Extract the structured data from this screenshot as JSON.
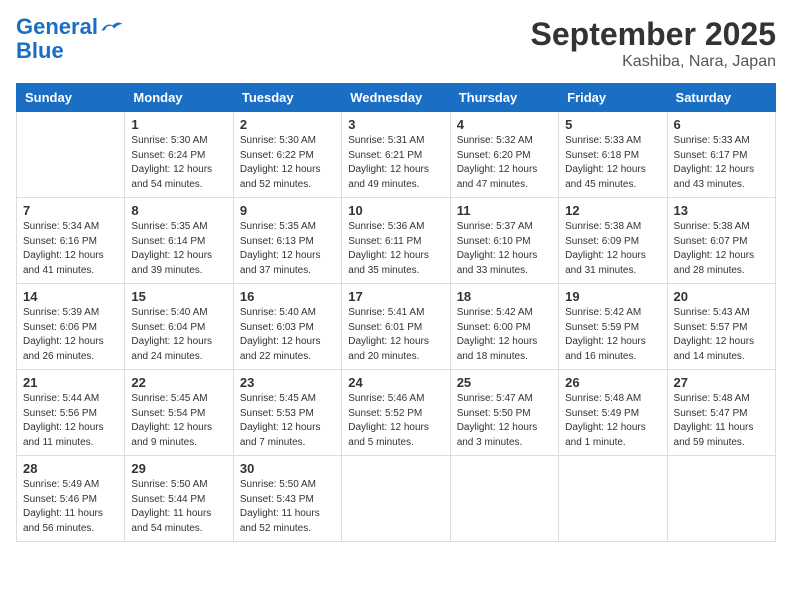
{
  "header": {
    "logo_top": "General",
    "logo_bottom": "Blue",
    "title": "September 2025",
    "subtitle": "Kashiba, Nara, Japan"
  },
  "columns": [
    "Sunday",
    "Monday",
    "Tuesday",
    "Wednesday",
    "Thursday",
    "Friday",
    "Saturday"
  ],
  "weeks": [
    [
      {
        "num": "",
        "info": ""
      },
      {
        "num": "1",
        "info": "Sunrise: 5:30 AM\nSunset: 6:24 PM\nDaylight: 12 hours\nand 54 minutes."
      },
      {
        "num": "2",
        "info": "Sunrise: 5:30 AM\nSunset: 6:22 PM\nDaylight: 12 hours\nand 52 minutes."
      },
      {
        "num": "3",
        "info": "Sunrise: 5:31 AM\nSunset: 6:21 PM\nDaylight: 12 hours\nand 49 minutes."
      },
      {
        "num": "4",
        "info": "Sunrise: 5:32 AM\nSunset: 6:20 PM\nDaylight: 12 hours\nand 47 minutes."
      },
      {
        "num": "5",
        "info": "Sunrise: 5:33 AM\nSunset: 6:18 PM\nDaylight: 12 hours\nand 45 minutes."
      },
      {
        "num": "6",
        "info": "Sunrise: 5:33 AM\nSunset: 6:17 PM\nDaylight: 12 hours\nand 43 minutes."
      }
    ],
    [
      {
        "num": "7",
        "info": "Sunrise: 5:34 AM\nSunset: 6:16 PM\nDaylight: 12 hours\nand 41 minutes."
      },
      {
        "num": "8",
        "info": "Sunrise: 5:35 AM\nSunset: 6:14 PM\nDaylight: 12 hours\nand 39 minutes."
      },
      {
        "num": "9",
        "info": "Sunrise: 5:35 AM\nSunset: 6:13 PM\nDaylight: 12 hours\nand 37 minutes."
      },
      {
        "num": "10",
        "info": "Sunrise: 5:36 AM\nSunset: 6:11 PM\nDaylight: 12 hours\nand 35 minutes."
      },
      {
        "num": "11",
        "info": "Sunrise: 5:37 AM\nSunset: 6:10 PM\nDaylight: 12 hours\nand 33 minutes."
      },
      {
        "num": "12",
        "info": "Sunrise: 5:38 AM\nSunset: 6:09 PM\nDaylight: 12 hours\nand 31 minutes."
      },
      {
        "num": "13",
        "info": "Sunrise: 5:38 AM\nSunset: 6:07 PM\nDaylight: 12 hours\nand 28 minutes."
      }
    ],
    [
      {
        "num": "14",
        "info": "Sunrise: 5:39 AM\nSunset: 6:06 PM\nDaylight: 12 hours\nand 26 minutes."
      },
      {
        "num": "15",
        "info": "Sunrise: 5:40 AM\nSunset: 6:04 PM\nDaylight: 12 hours\nand 24 minutes."
      },
      {
        "num": "16",
        "info": "Sunrise: 5:40 AM\nSunset: 6:03 PM\nDaylight: 12 hours\nand 22 minutes."
      },
      {
        "num": "17",
        "info": "Sunrise: 5:41 AM\nSunset: 6:01 PM\nDaylight: 12 hours\nand 20 minutes."
      },
      {
        "num": "18",
        "info": "Sunrise: 5:42 AM\nSunset: 6:00 PM\nDaylight: 12 hours\nand 18 minutes."
      },
      {
        "num": "19",
        "info": "Sunrise: 5:42 AM\nSunset: 5:59 PM\nDaylight: 12 hours\nand 16 minutes."
      },
      {
        "num": "20",
        "info": "Sunrise: 5:43 AM\nSunset: 5:57 PM\nDaylight: 12 hours\nand 14 minutes."
      }
    ],
    [
      {
        "num": "21",
        "info": "Sunrise: 5:44 AM\nSunset: 5:56 PM\nDaylight: 12 hours\nand 11 minutes."
      },
      {
        "num": "22",
        "info": "Sunrise: 5:45 AM\nSunset: 5:54 PM\nDaylight: 12 hours\nand 9 minutes."
      },
      {
        "num": "23",
        "info": "Sunrise: 5:45 AM\nSunset: 5:53 PM\nDaylight: 12 hours\nand 7 minutes."
      },
      {
        "num": "24",
        "info": "Sunrise: 5:46 AM\nSunset: 5:52 PM\nDaylight: 12 hours\nand 5 minutes."
      },
      {
        "num": "25",
        "info": "Sunrise: 5:47 AM\nSunset: 5:50 PM\nDaylight: 12 hours\nand 3 minutes."
      },
      {
        "num": "26",
        "info": "Sunrise: 5:48 AM\nSunset: 5:49 PM\nDaylight: 12 hours\nand 1 minute."
      },
      {
        "num": "27",
        "info": "Sunrise: 5:48 AM\nSunset: 5:47 PM\nDaylight: 11 hours\nand 59 minutes."
      }
    ],
    [
      {
        "num": "28",
        "info": "Sunrise: 5:49 AM\nSunset: 5:46 PM\nDaylight: 11 hours\nand 56 minutes."
      },
      {
        "num": "29",
        "info": "Sunrise: 5:50 AM\nSunset: 5:44 PM\nDaylight: 11 hours\nand 54 minutes."
      },
      {
        "num": "30",
        "info": "Sunrise: 5:50 AM\nSunset: 5:43 PM\nDaylight: 11 hours\nand 52 minutes."
      },
      {
        "num": "",
        "info": ""
      },
      {
        "num": "",
        "info": ""
      },
      {
        "num": "",
        "info": ""
      },
      {
        "num": "",
        "info": ""
      }
    ]
  ]
}
